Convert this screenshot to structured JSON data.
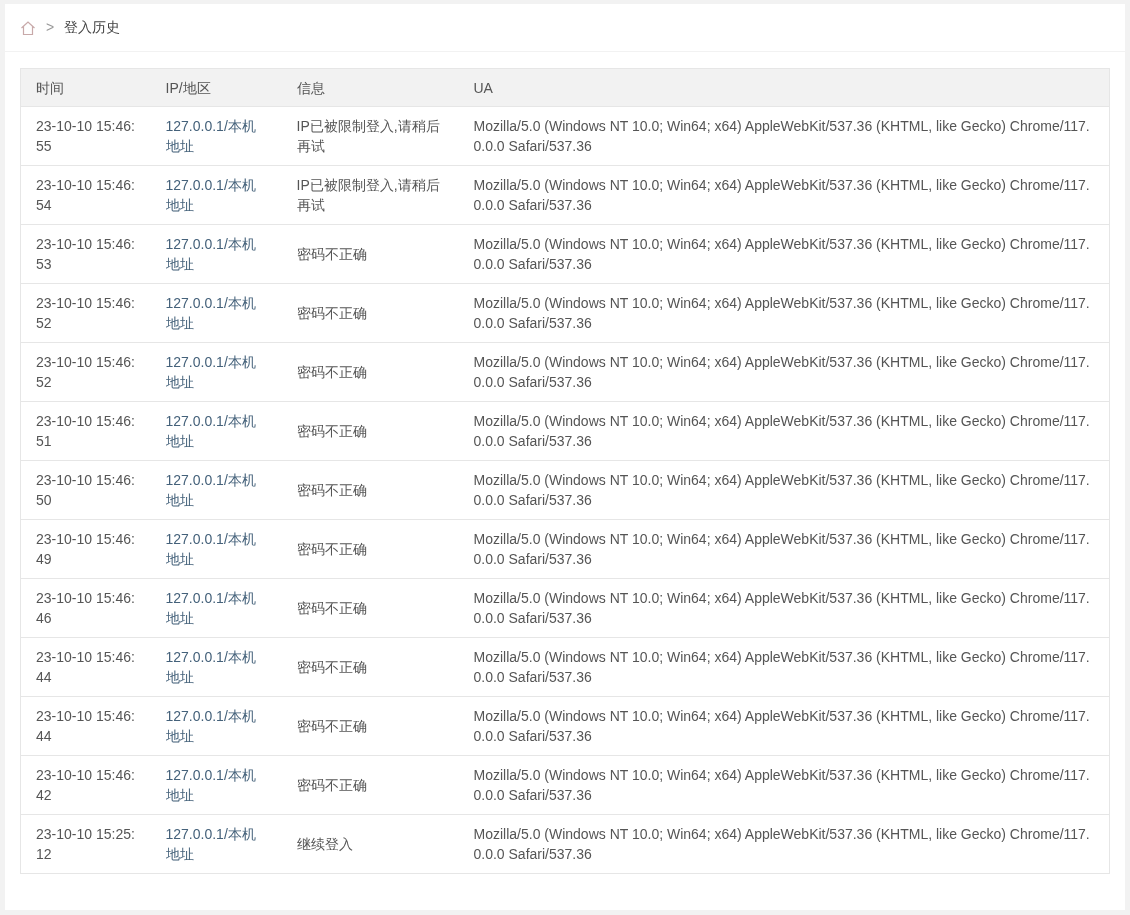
{
  "breadcrumb": {
    "separator": ">",
    "current": "登入历史"
  },
  "table": {
    "columns": [
      "时间",
      "IP/地区",
      "信息",
      "UA"
    ],
    "rows": [
      [
        "23-10-10 15:46:55",
        "127.0.0.1/本机地址",
        "IP已被限制登入,请稍后再试",
        "Mozilla/5.0 (Windows NT 10.0; Win64; x64) AppleWebKit/537.36 (KHTML, like Gecko) Chrome/117.0.0.0 Safari/537.36"
      ],
      [
        "23-10-10 15:46:54",
        "127.0.0.1/本机地址",
        "IP已被限制登入,请稍后再试",
        "Mozilla/5.0 (Windows NT 10.0; Win64; x64) AppleWebKit/537.36 (KHTML, like Gecko) Chrome/117.0.0.0 Safari/537.36"
      ],
      [
        "23-10-10 15:46:53",
        "127.0.0.1/本机地址",
        "密码不正确",
        "Mozilla/5.0 (Windows NT 10.0; Win64; x64) AppleWebKit/537.36 (KHTML, like Gecko) Chrome/117.0.0.0 Safari/537.36"
      ],
      [
        "23-10-10 15:46:52",
        "127.0.0.1/本机地址",
        "密码不正确",
        "Mozilla/5.0 (Windows NT 10.0; Win64; x64) AppleWebKit/537.36 (KHTML, like Gecko) Chrome/117.0.0.0 Safari/537.36"
      ],
      [
        "23-10-10 15:46:52",
        "127.0.0.1/本机地址",
        "密码不正确",
        "Mozilla/5.0 (Windows NT 10.0; Win64; x64) AppleWebKit/537.36 (KHTML, like Gecko) Chrome/117.0.0.0 Safari/537.36"
      ],
      [
        "23-10-10 15:46:51",
        "127.0.0.1/本机地址",
        "密码不正确",
        "Mozilla/5.0 (Windows NT 10.0; Win64; x64) AppleWebKit/537.36 (KHTML, like Gecko) Chrome/117.0.0.0 Safari/537.36"
      ],
      [
        "23-10-10 15:46:50",
        "127.0.0.1/本机地址",
        "密码不正确",
        "Mozilla/5.0 (Windows NT 10.0; Win64; x64) AppleWebKit/537.36 (KHTML, like Gecko) Chrome/117.0.0.0 Safari/537.36"
      ],
      [
        "23-10-10 15:46:49",
        "127.0.0.1/本机地址",
        "密码不正确",
        "Mozilla/5.0 (Windows NT 10.0; Win64; x64) AppleWebKit/537.36 (KHTML, like Gecko) Chrome/117.0.0.0 Safari/537.36"
      ],
      [
        "23-10-10 15:46:46",
        "127.0.0.1/本机地址",
        "密码不正确",
        "Mozilla/5.0 (Windows NT 10.0; Win64; x64) AppleWebKit/537.36 (KHTML, like Gecko) Chrome/117.0.0.0 Safari/537.36"
      ],
      [
        "23-10-10 15:46:44",
        "127.0.0.1/本机地址",
        "密码不正确",
        "Mozilla/5.0 (Windows NT 10.0; Win64; x64) AppleWebKit/537.36 (KHTML, like Gecko) Chrome/117.0.0.0 Safari/537.36"
      ],
      [
        "23-10-10 15:46:44",
        "127.0.0.1/本机地址",
        "密码不正确",
        "Mozilla/5.0 (Windows NT 10.0; Win64; x64) AppleWebKit/537.36 (KHTML, like Gecko) Chrome/117.0.0.0 Safari/537.36"
      ],
      [
        "23-10-10 15:46:42",
        "127.0.0.1/本机地址",
        "密码不正确",
        "Mozilla/5.0 (Windows NT 10.0; Win64; x64) AppleWebKit/537.36 (KHTML, like Gecko) Chrome/117.0.0.0 Safari/537.36"
      ],
      [
        "23-10-10 15:25:12",
        "127.0.0.1/本机地址",
        "继续登入",
        "Mozilla/5.0 (Windows NT 10.0; Win64; x64) AppleWebKit/537.36 (KHTML, like Gecko) Chrome/117.0.0.0 Safari/537.36"
      ]
    ]
  }
}
